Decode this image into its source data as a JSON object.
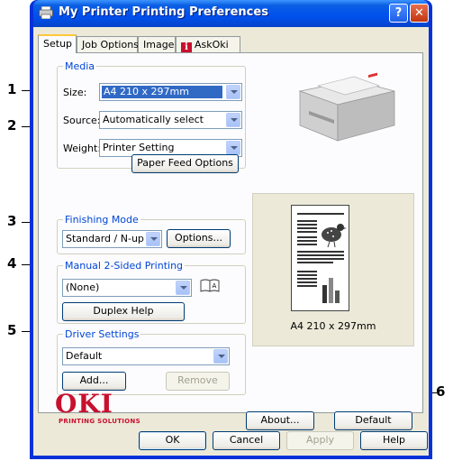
{
  "window": {
    "title": "My Printer Printing Preferences",
    "help_glyph": "?",
    "close_glyph": "✕"
  },
  "tabs": [
    {
      "label": "Setup"
    },
    {
      "label": "Job Options"
    },
    {
      "label": "Image"
    },
    {
      "label": "AskOki"
    }
  ],
  "media": {
    "group_label": "Media",
    "size_label": "Size:",
    "size_value": "A4 210 x 297mm",
    "source_label": "Source:",
    "source_value": "Automatically select",
    "weight_label": "Weight:",
    "weight_value": "Printer Setting",
    "paper_feed_button": "Paper Feed Options"
  },
  "finishing": {
    "group_label": "Finishing Mode",
    "value": "Standard / N-up",
    "options_button": "Options..."
  },
  "duplex": {
    "group_label": "Manual 2-Sided Printing",
    "value": "(None)",
    "help_button": "Duplex Help"
  },
  "driver": {
    "group_label": "Driver Settings",
    "value": "Default",
    "add_button": "Add...",
    "remove_button": "Remove"
  },
  "preview": {
    "caption": "A4 210 x 297mm"
  },
  "brand": {
    "logo": "OKI",
    "tagline": "PRINTING SOLUTIONS"
  },
  "buttons": {
    "about": "About...",
    "default": "Default",
    "ok": "OK",
    "cancel": "Cancel",
    "apply": "Apply",
    "help": "Help"
  },
  "callouts": [
    "1",
    "2",
    "3",
    "4",
    "5",
    "6"
  ],
  "colors": {
    "title_bar": "#0a5fe3",
    "group_label": "#0046d5",
    "brand_red": "#c8102e",
    "selection": "#316ac5"
  }
}
